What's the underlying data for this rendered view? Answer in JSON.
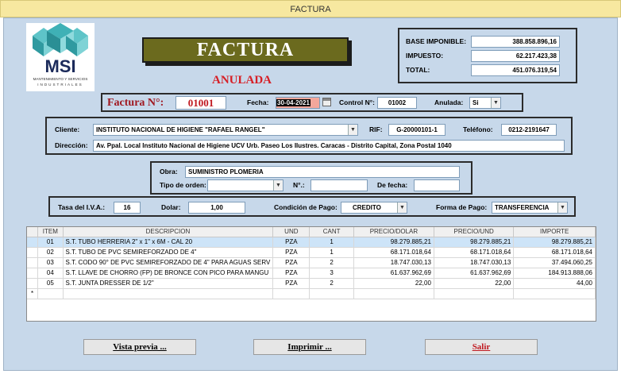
{
  "window": {
    "title": "FACTURA"
  },
  "logo": {
    "brand": "MSI",
    "subtitle_line1": "MANTENIMIENTO Y SERVICIOS",
    "subtitle_line2": "INDUSTRIALES"
  },
  "header": {
    "banner": "FACTURA",
    "status": "ANULADA"
  },
  "totals": {
    "base_label": "BASE IMPONIBLE:",
    "base_value": "388.858.896,16",
    "tax_label": "IMPUESTO:",
    "tax_value": "62.217.423,38",
    "total_label": "TOTAL:",
    "total_value": "451.076.319,54"
  },
  "invoice": {
    "number_label": "Factura N°:",
    "number_value": "01001",
    "date_label": "Fecha:",
    "date_value": "30-04-2021",
    "control_label": "Control N°:",
    "control_value": "01002",
    "annulled_label": "Anulada:",
    "annulled_value": "Si"
  },
  "client": {
    "client_label": "Cliente:",
    "client_value": "INSTITUTO NACIONAL DE HIGIENE \"RAFAEL RANGEL\"",
    "rif_label": "RIF:",
    "rif_value": "G-20000101-1",
    "phone_label": "Teléfono:",
    "phone_value": "0212-2191647",
    "address_label": "Dirección:",
    "address_value": "Av. Ppal. Local Instituto Nacional de Higiene UCV Urb. Paseo Los Ilustres. Caracas - Distrito Capital, Zona Postal 1040"
  },
  "work": {
    "obra_label": "Obra:",
    "obra_value": "SUMINISTRO PLOMERIA",
    "order_type_label": "Tipo de orden:",
    "order_type_value": "",
    "n_label": "N°.:",
    "n_value": "",
    "from_date_label": "De fecha:",
    "from_date_value": ""
  },
  "payment": {
    "iva_label": "Tasa del I.V.A.:",
    "iva_value": "16",
    "dollar_label": "Dolar:",
    "dollar_value": "1,00",
    "condition_label": "Condición de Pago:",
    "condition_value": "CREDITO",
    "method_label": "Forma de Pago:",
    "method_value": "TRANSFERENCIA"
  },
  "table": {
    "columns": [
      "ITEM",
      "DESCRIPCION",
      "UND",
      "CANT",
      "PRECIO/DOLAR",
      "PRECIO/UND",
      "IMPORTE"
    ],
    "rows": [
      [
        "01",
        "S.T. TUBO HERRERIA 2\" x 1\" x 6M - CAL 20",
        "PZA",
        "1",
        "98.279.885,21",
        "98.279.885,21",
        "98.279.885,21"
      ],
      [
        "02",
        "S.T. TUBO DE PVC SEMIREFORZADO DE 4\"",
        "PZA",
        "1",
        "68.171.018,64",
        "68.171.018,64",
        "68.171.018,64"
      ],
      [
        "03",
        "S.T. CODO 90° DE PVC SEMIREFORZADO DE 4\" PARA AGUAS SERV",
        "PZA",
        "2",
        "18.747.030,13",
        "18.747.030,13",
        "37.494.060,25"
      ],
      [
        "04",
        "S.T. LLAVE DE CHORRO (FP) DE BRONCE CON PICO PARA MANGU",
        "PZA",
        "3",
        "61.637.962,69",
        "61.637.962,69",
        "184.913.888,06"
      ],
      [
        "05",
        "S.T.  JUNTA DRESSER DE 1/2\"",
        "PZA",
        "2",
        "22,00",
        "22,00",
        "44,00"
      ]
    ],
    "new_row_marker": "*"
  },
  "buttons": {
    "preview": "Vista previa ...",
    "print": "Imprimir ...",
    "exit": "Salir"
  },
  "colors": {
    "form_bg": "#c7d8ea",
    "banner_bg": "#6b6a1e",
    "accent_red": "#d61f26",
    "title_bar": "#f7e8a0"
  }
}
